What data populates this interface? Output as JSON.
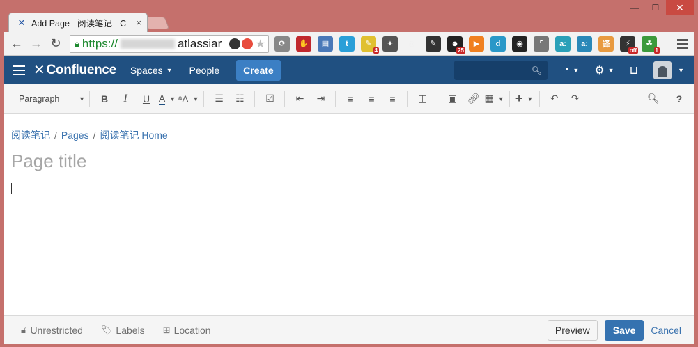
{
  "tab": {
    "title": "Add Page - 阅读笔记 - C",
    "close": "×"
  },
  "window": {
    "minimize": "—",
    "maximize": "☐",
    "close": "✕"
  },
  "browser": {
    "url_scheme": "https://",
    "url_host": "atlassiar",
    "extensions": [
      {
        "name": "arrows-icon",
        "color": "#888888",
        "glyph": "⟳",
        "badge": ""
      },
      {
        "name": "adblock-icon",
        "color": "#c0282d",
        "glyph": "✋",
        "badge": ""
      },
      {
        "name": "scanner-icon",
        "color": "#4a79b8",
        "glyph": "▤",
        "badge": ""
      },
      {
        "name": "twitter-icon",
        "color": "#2a9fd8",
        "glyph": "t",
        "badge": ""
      },
      {
        "name": "note-icon",
        "color": "#e0c030",
        "glyph": "✎",
        "badge": "4"
      },
      {
        "name": "pin-icon",
        "color": "#555555",
        "glyph": "✦",
        "badge": ""
      },
      {
        "name": "ring-icon",
        "color": "#f0f0f0",
        "glyph": "◎",
        "badge": ""
      },
      {
        "name": "edit-icon",
        "color": "#333333",
        "glyph": "✎",
        "badge": ""
      },
      {
        "name": "sync-icon",
        "color": "#222222",
        "glyph": "☻",
        "badge": "25"
      },
      {
        "name": "play-icon",
        "color": "#f08020",
        "glyph": "▶",
        "badge": ""
      },
      {
        "name": "d-icon",
        "color": "#2a98c8",
        "glyph": "d",
        "badge": ""
      },
      {
        "name": "color-icon",
        "color": "#222222",
        "glyph": "◉",
        "badge": ""
      },
      {
        "name": "bracket-icon",
        "color": "#777777",
        "glyph": "⌜",
        "badge": ""
      },
      {
        "name": "a-icon",
        "color": "#2aa0b8",
        "glyph": "a:",
        "badge": ""
      },
      {
        "name": "a2-icon",
        "color": "#2a88b8",
        "glyph": "a:",
        "badge": ""
      },
      {
        "name": "translate-icon",
        "color": "#e89a40",
        "glyph": "译",
        "badge": ""
      },
      {
        "name": "off-icon",
        "color": "#333333",
        "glyph": "⚡",
        "badge": "off"
      },
      {
        "name": "tree-icon",
        "color": "#3c9a3c",
        "glyph": "☘",
        "badge": "1"
      }
    ]
  },
  "header": {
    "logo": "Confluence",
    "spaces": "Spaces",
    "people": "People",
    "create": "Create",
    "search_icon": "search-icon"
  },
  "editor_toolbar": {
    "paragraph": "Paragraph",
    "bold": "B",
    "italic": "I",
    "underline": "U",
    "text_color": "A",
    "more_format": "ᵃA"
  },
  "content": {
    "breadcrumb": [
      "阅读笔记",
      "Pages",
      "阅读笔记 Home"
    ],
    "title_placeholder": "Page title"
  },
  "footer": {
    "restrictions": "Unrestricted",
    "labels": "Labels",
    "location": "Location",
    "preview": "Preview",
    "save": "Save",
    "cancel": "Cancel"
  }
}
